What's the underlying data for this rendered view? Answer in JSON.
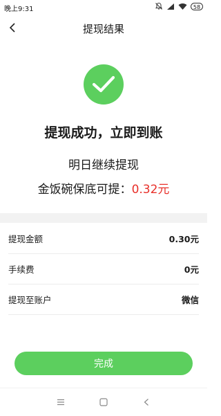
{
  "status_bar": {
    "time": "晚上9:31",
    "battery": "58"
  },
  "header": {
    "title": "提现结果"
  },
  "result": {
    "headline": "提现成功，立即到账",
    "subtext": "明日继续提现",
    "guarantee_label": "金饭碗保底可提：",
    "guarantee_amount": "0.32元"
  },
  "details": [
    {
      "label": "提现金额",
      "value": "0.30元"
    },
    {
      "label": "手续费",
      "value": "0元"
    },
    {
      "label": "提现至账户",
      "value": "微信"
    }
  ],
  "actions": {
    "done_label": "完成"
  },
  "colors": {
    "accent": "#5ccf5e",
    "highlight": "#e8302a"
  }
}
